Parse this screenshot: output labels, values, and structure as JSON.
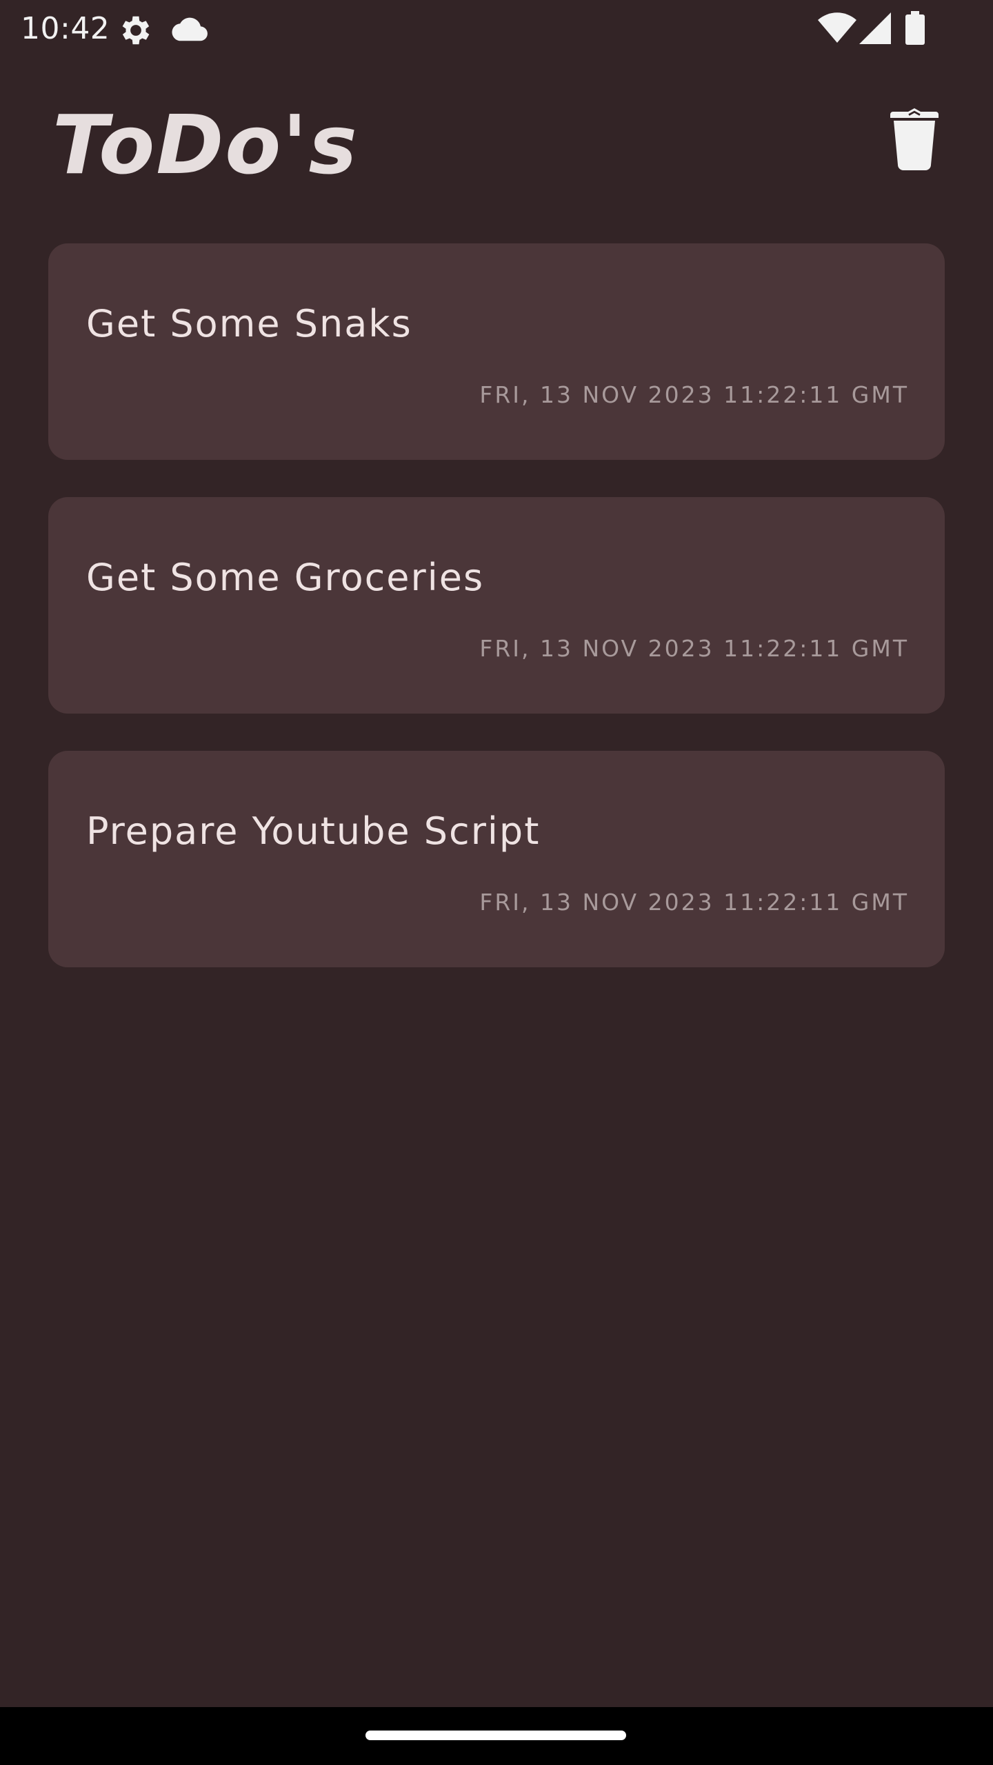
{
  "status_bar": {
    "time": "10:42",
    "icons": [
      "settings-gear-icon",
      "cloud-icon",
      "wifi-icon",
      "cellular-signal-icon",
      "battery-icon"
    ]
  },
  "header": {
    "title": "ToDo's",
    "delete_icon": "trash-can-icon"
  },
  "todos": [
    {
      "title": "Get Some Snaks",
      "date": "FRI, 13 NOV 2023 11:22:11 GMT"
    },
    {
      "title": "Get Some Groceries",
      "date": "FRI, 13 NOV 2023 11:22:11 GMT"
    },
    {
      "title": "Prepare Youtube Script",
      "date": "FRI, 13 NOV 2023 11:22:11 GMT"
    }
  ],
  "colors": {
    "background": "#332426",
    "card": "#4b3639",
    "title_text": "#e6dede",
    "item_text": "#efe3e3",
    "date_text": "#a89a9b",
    "nav_bar": "#000000"
  }
}
